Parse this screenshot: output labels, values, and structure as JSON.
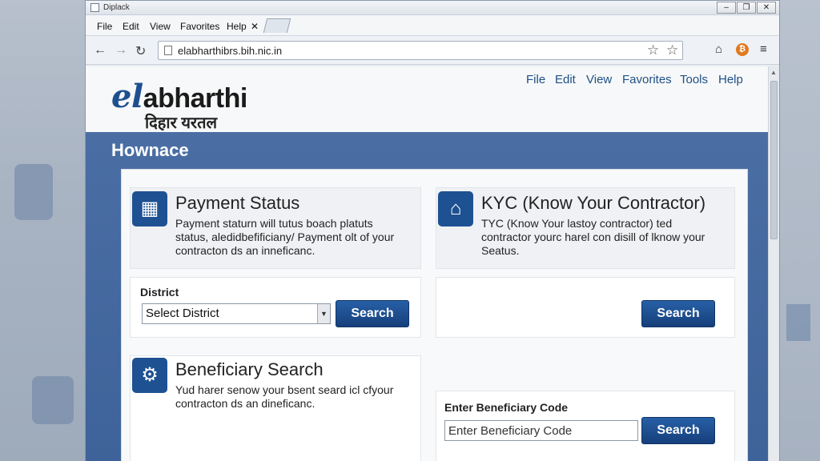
{
  "window": {
    "title": "Diplack",
    "controls": [
      "–",
      "❐",
      "✕"
    ]
  },
  "browser_menu": [
    "File",
    "Edit",
    "View",
    "Favorites",
    "Help",
    "✕"
  ],
  "address": {
    "url": "elabharthibrs.bih.nic.in"
  },
  "nav_icons": {
    "back": "←",
    "forward": "→",
    "reload": "↻",
    "star1": "☆",
    "star2": "☆",
    "home": "⌂",
    "ext": "₿",
    "menu": "≡"
  },
  "site": {
    "logo_prefix": "el",
    "logo_rest": "abharthi",
    "logo_sub": "दिहार यरतल",
    "menu": [
      "File",
      "Edit",
      "View",
      "Favorites",
      "Tools",
      "Help"
    ],
    "section_title": "Hownace"
  },
  "cards": {
    "payment": {
      "title": "Payment Status",
      "desc": [
        "Payment staturn will tutus boach platuts",
        "status, aledidbefificiany/ Payment olt of your",
        "contracton ds an inneficanc."
      ],
      "district_label": "District",
      "district_select": "Select District",
      "button": "Search",
      "icon": "payment-icon"
    },
    "kyc": {
      "title": "KYC (Know Your Contractor)",
      "desc": [
        "TYC (Know Your lastoy contractor) ted",
        "contractor yourc harel con disill of lknow your",
        "Seatus."
      ],
      "button": "Search",
      "icon": "contractor-icon"
    },
    "beneficiary": {
      "title": "Beneficiary Search",
      "desc": [
        "Yud harer senow your bsent seard icl cfyour",
        "contracton ds an dineficanc."
      ],
      "code_label": "Enter Beneficiary Code",
      "code_placeholder": "Enter Beneficiary Code",
      "button": "Search",
      "icon": "gear-icon"
    }
  }
}
